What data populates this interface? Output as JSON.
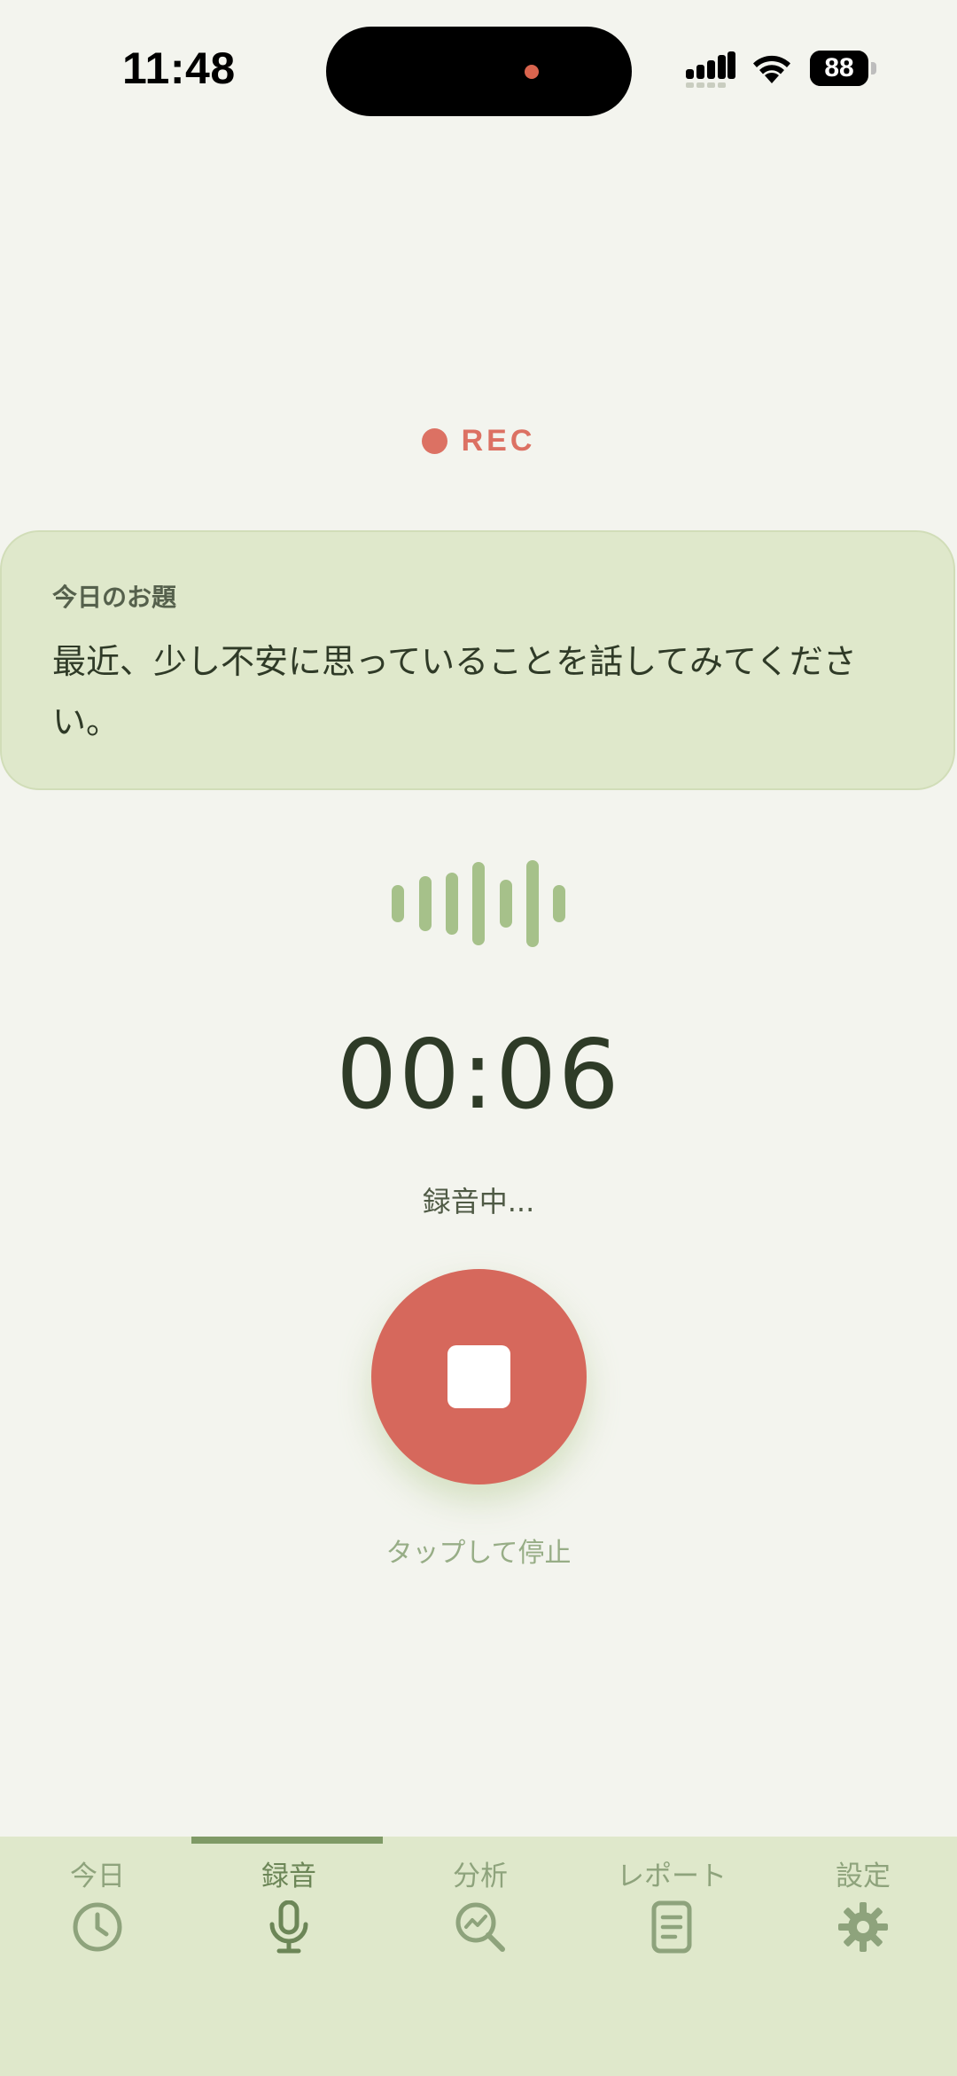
{
  "status_bar": {
    "time": "11:48",
    "battery": "88"
  },
  "recording": {
    "rec_label": "REC",
    "timer": "00:06",
    "status": "録音中...",
    "stop_hint": "タップして停止"
  },
  "prompt": {
    "heading": "今日のお題",
    "text": "最近、少し不安に思っていることを話してみてください。"
  },
  "tabs": [
    {
      "label": "今日",
      "icon": "clock-icon"
    },
    {
      "label": "録音",
      "icon": "microphone-icon"
    },
    {
      "label": "分析",
      "icon": "analysis-search-icon"
    },
    {
      "label": "レポート",
      "icon": "document-icon"
    },
    {
      "label": "設定",
      "icon": "gear-icon"
    }
  ],
  "active_tab": "録音",
  "colors": {
    "background": "#f3f4ee",
    "card": "#dfe8cb",
    "accent_red": "#d6685c",
    "accent_green": "#a6c18a",
    "tab_active": "#7f9a66"
  }
}
